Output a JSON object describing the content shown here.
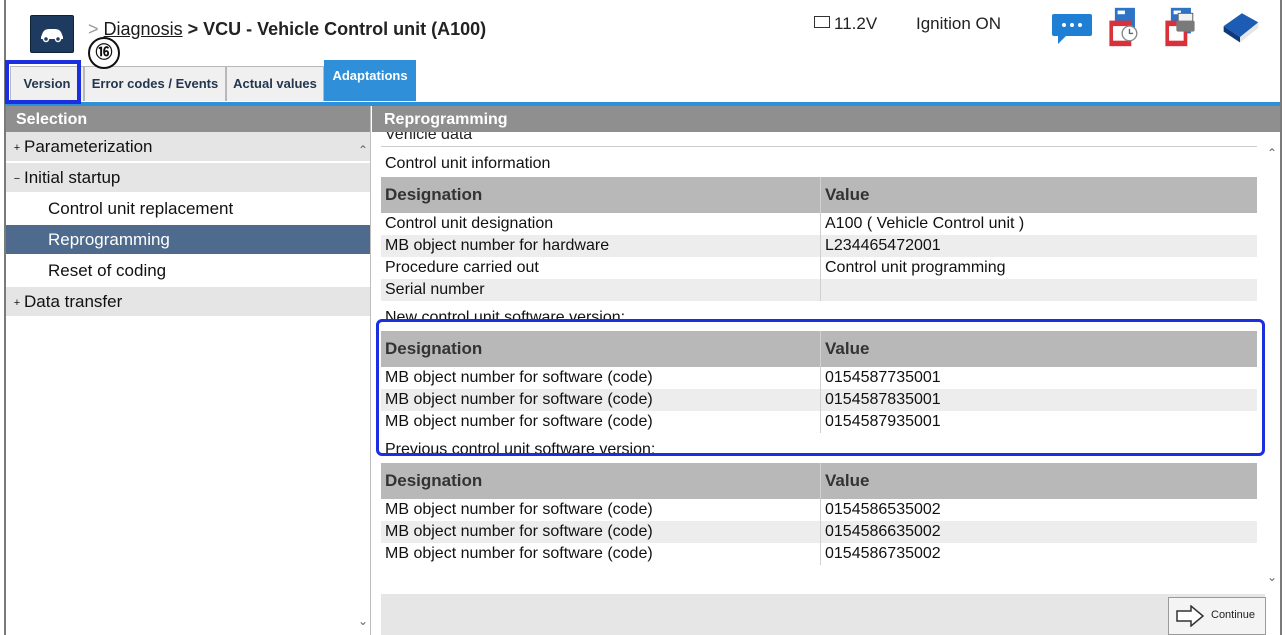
{
  "header": {
    "crumb_sep": ">",
    "crumb_link": "Diagnosis",
    "crumb_current": "> VCU - Vehicle Control unit (A100)",
    "voltage": "11.2V",
    "ignition": "Ignition ON",
    "icons": [
      "car-icon",
      "chat-icon",
      "pdf-report-icon",
      "pdf-print-icon",
      "book-icon"
    ]
  },
  "tabs": [
    {
      "label": "Version",
      "active": false
    },
    {
      "label": "Error codes / Events",
      "active": false
    },
    {
      "label": "Actual values",
      "active": false
    },
    {
      "label": "Adaptations",
      "active": true
    }
  ],
  "annotation": {
    "badge": "⑯"
  },
  "colors": {
    "accent": "#2f8fd8",
    "selected": "#4e6a8c",
    "highlight": "#1b2fe0",
    "pane_header": "#8f8f8f"
  },
  "selection": {
    "title": "Selection",
    "items": [
      {
        "label": "Parameterization",
        "toggle": "+"
      },
      {
        "label": "Initial startup",
        "toggle": "−"
      },
      {
        "label": "Control unit replacement"
      },
      {
        "label": "Reprogramming"
      },
      {
        "label": "Reset of coding"
      },
      {
        "label": "Data transfer",
        "toggle": "+"
      }
    ]
  },
  "reprogramming": {
    "title": "Reprogramming",
    "vehicle_data": "Vehicle data",
    "col_designation": "Designation",
    "col_value": "Value",
    "control_unit_info": {
      "title": "Control unit information",
      "rows": [
        {
          "designation": "Control unit designation",
          "value": "A100 ( Vehicle Control unit )"
        },
        {
          "designation": "MB object number for hardware",
          "value": "L234465472001"
        },
        {
          "designation": "Procedure carried out",
          "value": "Control unit programming"
        },
        {
          "designation": "Serial number",
          "value": ""
        }
      ]
    },
    "new_version": {
      "title": "New control unit software version:",
      "rows": [
        {
          "designation": "MB object number for software (code)",
          "value": "0154587735001"
        },
        {
          "designation": "MB object number for software (code)",
          "value": "0154587835001"
        },
        {
          "designation": "MB object number for software (code)",
          "value": "0154587935001"
        }
      ]
    },
    "previous_version": {
      "title": "Previous control unit software version:",
      "rows": [
        {
          "designation": "MB object number for software (code)",
          "value": "0154586535002"
        },
        {
          "designation": "MB object number for software (code)",
          "value": "0154586635002"
        },
        {
          "designation": "MB object number for software (code)",
          "value": "0154586735002"
        }
      ]
    }
  },
  "footer": {
    "continue_label": "Continue"
  }
}
